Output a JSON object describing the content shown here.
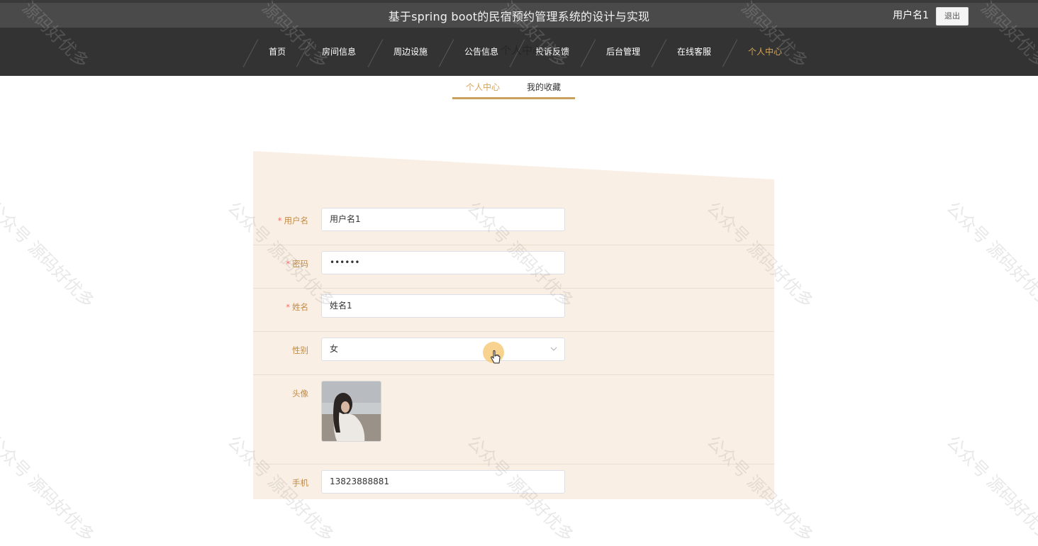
{
  "header": {
    "site_title": "基于spring boot的民宿预约管理系统的设计与实现",
    "user_name": "用户名1",
    "logout_label": "退出"
  },
  "nav": {
    "items": [
      "首页",
      "房间信息",
      "周边设施",
      "公告信息",
      "投诉反馈",
      "后台管理",
      "在线客服",
      "个人中心"
    ],
    "active": "个人中心",
    "overlay_title": "个人中心"
  },
  "subtabs": {
    "profile_label": "个人中心",
    "favorites_label": "我的收藏"
  },
  "form": {
    "username": {
      "label": "用户名",
      "required": "*",
      "value": "用户名1"
    },
    "password": {
      "label": "密码",
      "required": "*",
      "value": "••••••"
    },
    "realname": {
      "label": "姓名",
      "required": "*",
      "value": "姓名1"
    },
    "gender": {
      "label": "性别",
      "value": "女"
    },
    "avatar": {
      "label": "头像"
    },
    "phone": {
      "label": "手机",
      "value": "13823888881"
    }
  },
  "watermarks": {
    "top": "源码好优多",
    "body": "公众号 源码好优多"
  },
  "colors": {
    "accent": "#d4a55a",
    "panel": "#faefe4",
    "nav_bg": "#333333",
    "topbar_bg": "#4a4a4a"
  }
}
